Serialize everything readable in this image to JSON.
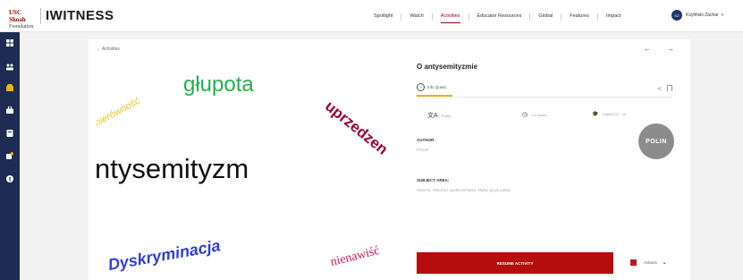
{
  "header": {
    "logo": {
      "line1": "USC Shoah",
      "line2": "Foundation",
      "wordmark": "IWITNESS"
    },
    "nav": [
      {
        "label": "Spotlight",
        "active": false
      },
      {
        "label": "Watch",
        "active": false
      },
      {
        "label": "Activities",
        "active": true
      },
      {
        "label": "Educator Resources",
        "active": false
      },
      {
        "label": "Global",
        "active": false
      },
      {
        "label": "Features",
        "active": false
      },
      {
        "label": "Impact",
        "active": false
      }
    ],
    "user": {
      "initials": "KZ",
      "name": "Ksyfiński Zachar",
      "caret": "▾"
    }
  },
  "sidebar": {
    "icons": [
      "dashboard-icon",
      "community-icon",
      "inbox-icon",
      "bag-icon",
      "archive-icon",
      "notifications-icon",
      "help-icon"
    ]
  },
  "breadcrumb": {
    "back_label": "Activities",
    "prev": "←",
    "next": "→"
  },
  "cover": {
    "words": {
      "glupota": "głupota",
      "uprzedzenia": "uprzedzen",
      "nierownosc": "nierówność",
      "antysemityzm": "ntysemityzm",
      "dyskryminacja": "Dyskryminacja",
      "nienawisc": "nienawiść"
    }
  },
  "activity": {
    "title": "O antysemityzmie",
    "tab": {
      "icon": "?",
      "label": "Info Quest"
    },
    "meta": [
      {
        "icon": "translate-icon",
        "glyph": "文A",
        "text": "Polish"
      },
      {
        "icon": "clock-icon",
        "glyph": "◷",
        "text": "1,5 Hours"
      },
      {
        "icon": "mortarboard-icon",
        "glyph": "🎓",
        "text": "Grades 10 - 12"
      }
    ],
    "author": {
      "heading": "AUTHOR:",
      "value": "POLIN"
    },
    "subject": {
      "heading": "SUBJECT AREA:",
      "value": "Historia, Historia i społeczeństwo, etyka, język polski"
    },
    "partner_logo": "POLIN",
    "resume_label": "RESUME ACTIVITY",
    "actions_label": "Actions",
    "actions_caret": "⌄"
  },
  "colors": {
    "sidebar": "#1e2b52",
    "accent": "#990000",
    "resume_button": "#b50d0d",
    "tab_underline": "#e8b50f"
  }
}
